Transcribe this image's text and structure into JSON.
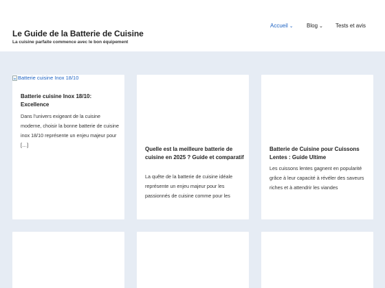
{
  "site": {
    "title": "Le Guide de la Batterie de Cuisine",
    "tagline": "La cuisine parfaite commence avec le bon équipement"
  },
  "nav": {
    "items": [
      {
        "label": "Accueil",
        "has_dropdown": true,
        "active": true
      },
      {
        "label": "Blog",
        "has_dropdown": true,
        "active": false
      },
      {
        "label": "Tests et avis",
        "has_dropdown": false,
        "active": false
      }
    ]
  },
  "posts": [
    {
      "image_alt": "Batterie cuisine Inox 18/10",
      "title": "Batterie cuisine Inox 18/10: Excellence",
      "excerpt": "Dans l'univers exigeant de la cuisine moderne, choisir la bonne batterie de cuisine inox 18/10 représente un enjeu majeur pour […]"
    },
    {
      "title": "Quelle est la meilleure batterie de cuisine en 2025 ? Guide et comparatif",
      "excerpt": "La quête de la batterie de cuisine idéale représente un enjeu majeur pour les passionnés de cuisine comme pour les"
    },
    {
      "title": "Batterie de Cuisine pour Cuissons Lentes : Guide Ultime",
      "excerpt": "Les cuissons lentes gagnent en popularité grâce à leur capacité à révéler des saveurs riches et à attendrir les viandes"
    }
  ],
  "colors": {
    "accent": "#1e63c3",
    "background": "#e6ecf4",
    "card": "#ffffff"
  }
}
